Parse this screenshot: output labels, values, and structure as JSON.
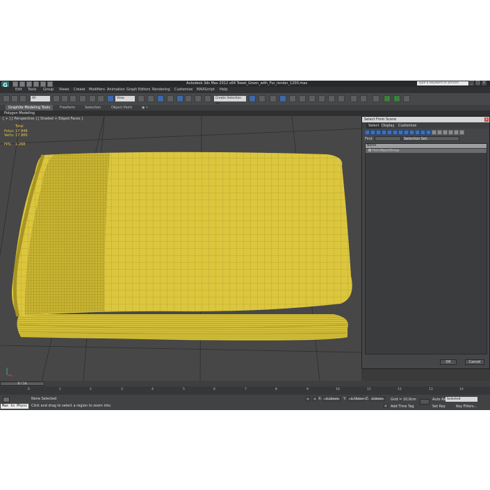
{
  "window": {
    "title": "Autodesk 3ds Max  2012 x64     Towel_Green_with_Fur_render_1200.max",
    "search_placeholder": "Type a keyword or phrase",
    "min": "_",
    "max": "□",
    "close": "x"
  },
  "menu": [
    "Edit",
    "Tools",
    "Group",
    "Views",
    "Create",
    "Modifiers",
    "Animation",
    "Graph Editors",
    "Rendering",
    "Customize",
    "MAXScript",
    "Help"
  ],
  "toolbar": {
    "selection_filter": "All",
    "ref_coord": "View",
    "named_selection": "Create Selection Se"
  },
  "ribbon": {
    "tabs": [
      "Graphite Modeling Tools",
      "Freeform",
      "Selection",
      "Object Paint"
    ],
    "extra": "◉ •",
    "panel_label": "Polygon Modeling"
  },
  "viewport": {
    "label": "[ + ] [ Perspective ] [ Shaded + Edged Faces ]",
    "stats": [
      {
        "label": "",
        "value": "Total"
      },
      {
        "label": "Polys:",
        "value": "17 848"
      },
      {
        "label": "Verts:",
        "value": "17 880"
      }
    ],
    "fps_label": "FPS:",
    "fps_value": "1.268"
  },
  "dialog": {
    "title": "Select From Scene",
    "close": "x",
    "tabs": [
      "Select",
      "Display",
      "Customize"
    ],
    "find_label": "Find:",
    "selection_set_label": "Selection Set:",
    "column_header": "Name",
    "items": [
      "Hero3bjectGroup"
    ],
    "ok": "OK",
    "cancel": "Cancel"
  },
  "timeline": {
    "slider": "0 / 14",
    "ticks": [
      "0",
      "1",
      "2",
      "3",
      "4",
      "5",
      "6",
      "7",
      "8",
      "9",
      "10",
      "11",
      "12",
      "13",
      "14"
    ]
  },
  "status": {
    "maxscript": "Max to Physc",
    "none_selected": "None Selected",
    "prompt": "Click and drag to select a region to zoom into",
    "x_label": "X:",
    "x_value": "-3,34mm",
    "y_label": "Y:",
    "y_value": "-3,764mm",
    "z_label": "Z:",
    "z_value": "0,0mm",
    "grid": "Grid = 10,0cm",
    "add_time_tag": "Add Time Tag",
    "auto_key": "Auto Key",
    "set_key": "Set Key",
    "selected": "Selected",
    "key_filters": "Key Filters..."
  },
  "colors": {
    "towel": "#d8c23c",
    "towel_dark": "#a89424",
    "wire": "#8a7e1e",
    "viewport_bg": "#474747",
    "stats_text": "#e8c64a"
  }
}
